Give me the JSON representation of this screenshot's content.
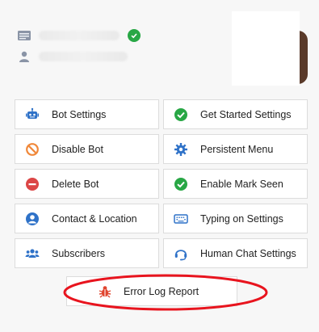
{
  "buttons": [
    {
      "label": "Bot Settings",
      "icon": "robot-icon",
      "color": "#2f72c8"
    },
    {
      "label": "Get Started Settings",
      "icon": "check-circle-icon",
      "color": "#28a745"
    },
    {
      "label": "Disable Bot",
      "icon": "ban-icon",
      "color": "#f0883a"
    },
    {
      "label": "Persistent Menu",
      "icon": "gear-icon",
      "color": "#2f72c8"
    },
    {
      "label": "Delete Bot",
      "icon": "minus-circle-icon",
      "color": "#dc4646"
    },
    {
      "label": "Enable Mark Seen",
      "icon": "check-circle-icon",
      "color": "#28a745"
    },
    {
      "label": "Contact & Location",
      "icon": "user-circle-icon",
      "color": "#2f72c8"
    },
    {
      "label": "Typing on Settings",
      "icon": "keyboard-icon",
      "color": "#2f72c8"
    },
    {
      "label": "Subscribers",
      "icon": "users-icon",
      "color": "#2f72c8"
    },
    {
      "label": "Human Chat Settings",
      "icon": "headset-icon",
      "color": "#2f72c8"
    }
  ],
  "error_log": {
    "label": "Error Log Report",
    "icon": "bug-icon",
    "color": "#e0452f"
  },
  "colors": {
    "highlight": "#e8141e",
    "verified": "#28a745"
  }
}
